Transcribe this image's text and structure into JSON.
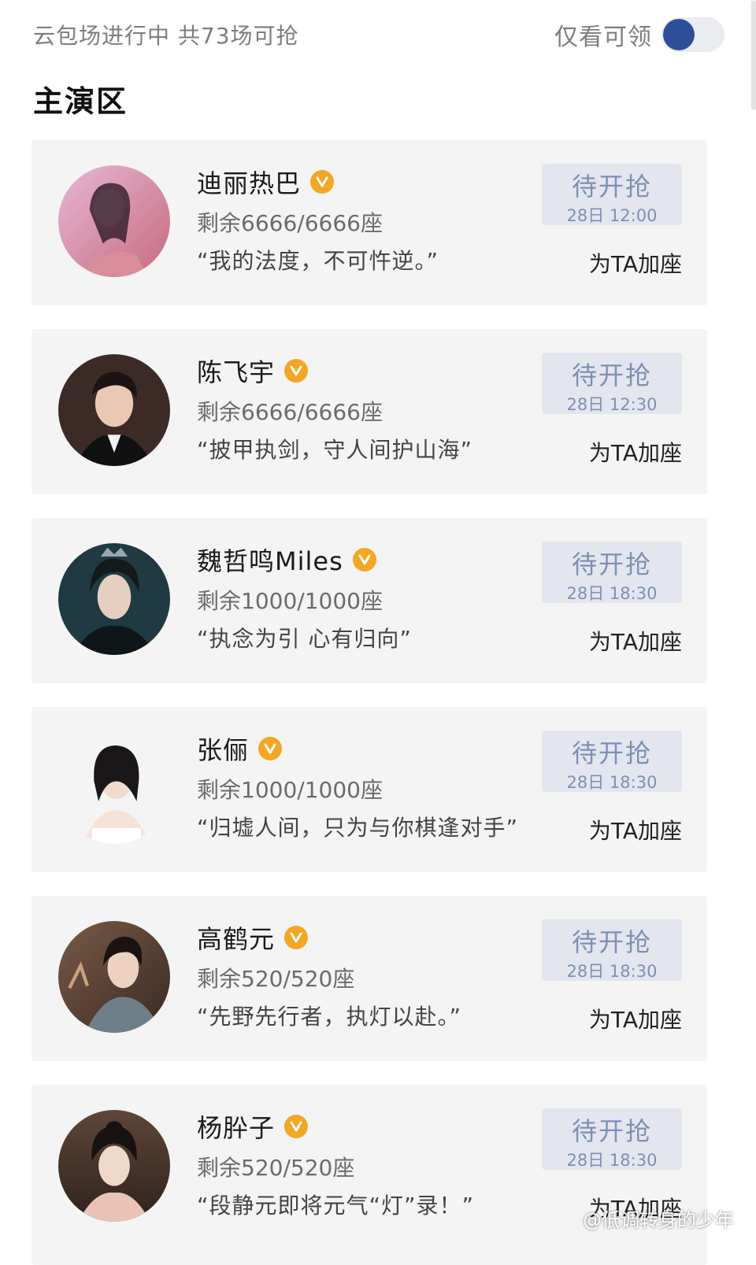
{
  "header": {
    "status_text": "云包场进行中 共73场可抢",
    "filter_label": "仅看可领",
    "filter_on": true
  },
  "section": {
    "title": "主演区"
  },
  "colors": {
    "accent": "#2d4f9a",
    "verified": "#f5a623",
    "button_bg": "#e3e6ee",
    "button_text": "#7e8fb5"
  },
  "cards": [
    {
      "name": "迪丽热巴",
      "verified_icon": "verified-badge-icon",
      "remaining": "剩余6666/6666座",
      "quote": "“我的法度，不可忤逆。”",
      "button_label": "待开抢",
      "button_time": "28日 12:00",
      "action_label": "为TA加座"
    },
    {
      "name": "陈飞宇",
      "verified_icon": "verified-badge-icon",
      "remaining": "剩余6666/6666座",
      "quote": "“披甲执剑，守人间护山海”",
      "button_label": "待开抢",
      "button_time": "28日 12:30",
      "action_label": "为TA加座"
    },
    {
      "name": "魏哲鸣Miles",
      "verified_icon": "verified-badge-icon",
      "remaining": "剩余1000/1000座",
      "quote": "“执念为引 心有归向”",
      "button_label": "待开抢",
      "button_time": "28日 18:30",
      "action_label": "为TA加座"
    },
    {
      "name": "张俪",
      "verified_icon": "verified-badge-icon",
      "remaining": "剩余1000/1000座",
      "quote": "“归墟人间，只为与你棋逢对手”",
      "button_label": "待开抢",
      "button_time": "28日 18:30",
      "action_label": "为TA加座"
    },
    {
      "name": "高鹤元",
      "verified_icon": "verified-badge-icon",
      "remaining": "剩余520/520座",
      "quote": "“先野先行者，执灯以赴。”",
      "button_label": "待开抢",
      "button_time": "28日 18:30",
      "action_label": "为TA加座"
    },
    {
      "name": "杨肸子",
      "verified_icon": "verified-badge-icon",
      "remaining": "剩余520/520座",
      "quote": "“段静元即将元气“灯”录！”",
      "button_label": "待开抢",
      "button_time": "28日 18:30",
      "action_label": "为TA加座"
    }
  ],
  "watermark": "@低调转身的少年"
}
